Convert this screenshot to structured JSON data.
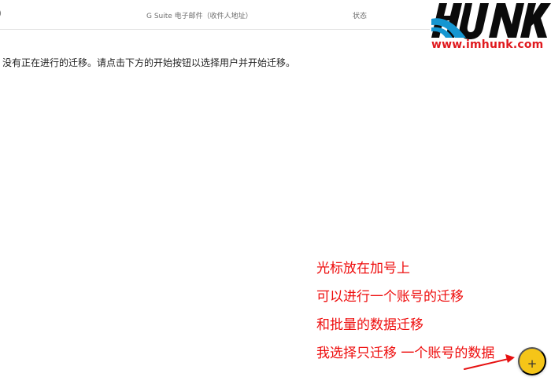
{
  "header": {
    "left_fragment": ")",
    "email_column": "G Suite 电子邮件（收件人地址）",
    "status_column": "状态"
  },
  "main": {
    "empty_message": "没有正在进行的迁移。请点击下方的开始按钮以选择用户并开始迁移。"
  },
  "watermark": {
    "url": "www.imhunk.com",
    "brand_colors": [
      "#0b0b0b",
      "#1596d1",
      "#e0191e"
    ]
  },
  "annotation": {
    "lines": [
      "光标放在加号上",
      "可以进行一个账号的迁移",
      "和批量的数据迁移",
      "我选择只迁移 一个账号的数据"
    ],
    "color": "#ee0c0c"
  },
  "fab": {
    "label": "+",
    "color": "#f5c518"
  }
}
